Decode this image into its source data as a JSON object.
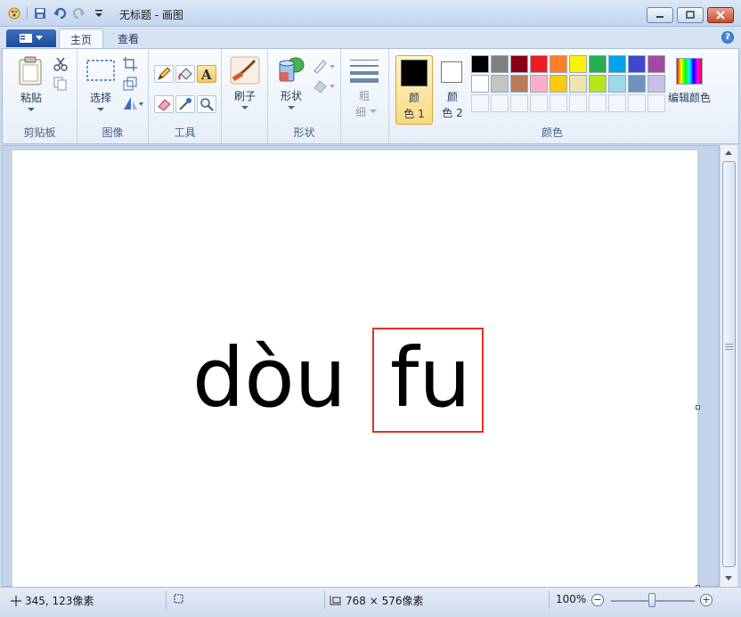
{
  "window": {
    "title": "无标题 - 画图"
  },
  "tabs": [
    {
      "label": "主页",
      "active": true
    },
    {
      "label": "查看",
      "active": false
    }
  ],
  "ribbon": {
    "clipboard": {
      "paste_label": "粘贴",
      "group_label": "剪贴板"
    },
    "image": {
      "select_label": "选择",
      "group_label": "图像"
    },
    "tools": {
      "group_label": "工具"
    },
    "brushes": {
      "label": "刷子"
    },
    "shapes": {
      "label": "形状",
      "group_label": "形状"
    },
    "size": {
      "label_line1": "粗",
      "label_line2": "细"
    },
    "colors": {
      "color1_line1": "颜",
      "color1_line2": "色 1",
      "color2_line1": "颜",
      "color2_line2": "色 2",
      "edit_label": "编辑颜色",
      "group_label": "颜色",
      "palette_row1": [
        "#000000",
        "#7f7f7f",
        "#880015",
        "#ed1c24",
        "#ff7f27",
        "#fff200",
        "#22b14c",
        "#00a2e8",
        "#3f48cc",
        "#a349a4"
      ],
      "palette_row2": [
        "#ffffff",
        "#c3c3c3",
        "#b97a57",
        "#ffaec9",
        "#ffc90e",
        "#efe4b0",
        "#b5e61d",
        "#99d9ea",
        "#7092be",
        "#c8bfe7"
      ],
      "color1": "#000000",
      "color2": "#ffffff"
    }
  },
  "canvas": {
    "word1": "dòu",
    "word2": "fu",
    "highlight_color": "#e0302c"
  },
  "statusbar": {
    "cursor_pos": "345, 123像素",
    "canvas_size": "768 × 576像素",
    "zoom": "100%"
  }
}
